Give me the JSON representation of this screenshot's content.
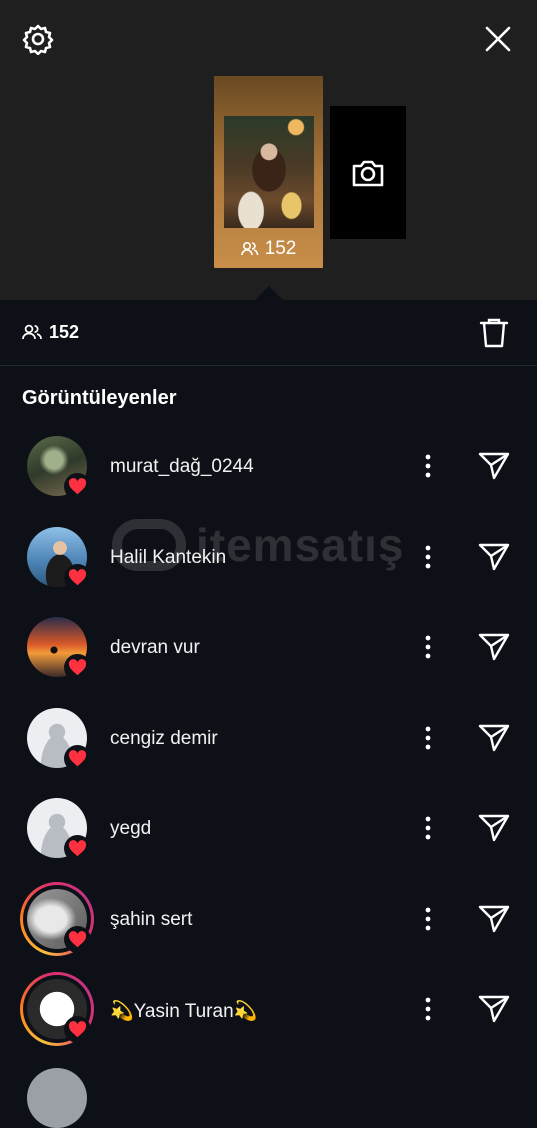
{
  "header": {
    "settings_icon": "gear-icon",
    "close_icon": "close-icon",
    "story": {
      "viewer_count": "152"
    },
    "add_story_icon": "camera-icon"
  },
  "stats": {
    "viewer_count": "152",
    "delete_icon": "trash-icon"
  },
  "section_title": "Görüntüleyenler",
  "watermark": "itemsatış",
  "viewers": [
    {
      "username": "murat_dağ_0244",
      "liked": true,
      "ring": false,
      "avatar": "forest"
    },
    {
      "username": "Halil Kantekin",
      "liked": true,
      "ring": false,
      "avatar": "sea"
    },
    {
      "username": "devran vur",
      "liked": true,
      "ring": false,
      "avatar": "sunset"
    },
    {
      "username": "cengiz demir",
      "liked": true,
      "ring": false,
      "avatar": "default"
    },
    {
      "username": "yegd",
      "liked": true,
      "ring": false,
      "avatar": "default"
    },
    {
      "username": "şahin sert",
      "liked": true,
      "ring": true,
      "avatar": "gray"
    },
    {
      "username": "💫Yasin Turan💫",
      "liked": true,
      "ring": true,
      "avatar": "yasin"
    }
  ],
  "colors": {
    "background": "#0d1117",
    "top_panel": "#1f1f1f",
    "heart": "#ff3040"
  }
}
